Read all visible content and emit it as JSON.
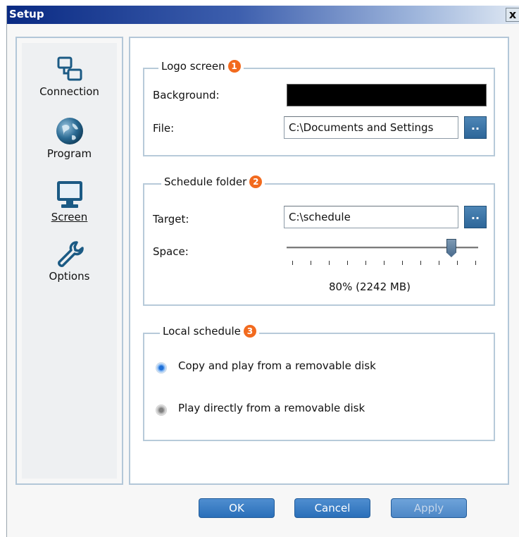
{
  "window": {
    "title": "Setup",
    "close_label": "x"
  },
  "sidebar": {
    "items": [
      {
        "label": "Connection",
        "icon": "connection-icon"
      },
      {
        "label": "Program",
        "icon": "globe-icon"
      },
      {
        "label": "Screen",
        "icon": "monitor-icon",
        "active": true
      },
      {
        "label": "Options",
        "icon": "wrench-icon"
      }
    ]
  },
  "logo_screen": {
    "legend": "Logo screen",
    "badge": "1",
    "background_label": "Background:",
    "background_color": "#000000",
    "file_label": "File:",
    "file_value": "C:\\Documents and Settings",
    "browse_label": ".."
  },
  "schedule_folder": {
    "legend": "Schedule folder",
    "badge": "2",
    "target_label": "Target:",
    "target_value": "C:\\schedule",
    "browse_label": "..",
    "space_label": "Space:",
    "space_value": "80% (2242 MB)",
    "space_fraction": 0.86
  },
  "local_schedule": {
    "legend": "Local schedule",
    "badge": "3",
    "options": [
      {
        "label": "Copy and play from a removable disk",
        "selected": true
      },
      {
        "label": "Play directly from a removable disk",
        "selected": false
      }
    ]
  },
  "buttons": {
    "ok": "OK",
    "cancel": "Cancel",
    "apply": "Apply"
  },
  "colors": {
    "accent": "#2a6fb9",
    "badge": "#f26a1e",
    "title_bar": "#0a2a83"
  }
}
